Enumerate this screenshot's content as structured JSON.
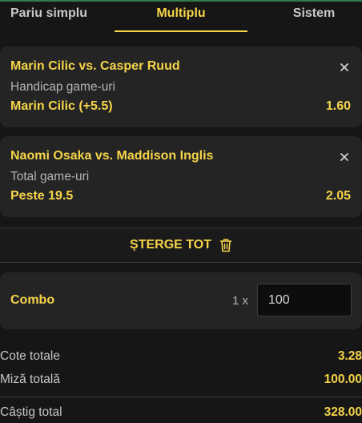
{
  "tabs": [
    {
      "label": "Pariu simplu",
      "active": false
    },
    {
      "label": "Multiplu",
      "active": true
    },
    {
      "label": "Sistem",
      "active": false
    }
  ],
  "selections": [
    {
      "match": "Marin Cilic vs. Casper Ruud",
      "market": "Handicap game-uri",
      "selection": "Marin Cilic (+5.5)",
      "odds": "1.60"
    },
    {
      "match": "Naomi Osaka vs. Maddison Inglis",
      "market": "Total game-uri",
      "selection": "Peste 19.5",
      "odds": "2.05"
    }
  ],
  "clear_all_label": "ȘTERGE TOT",
  "combo": {
    "label": "Combo",
    "multiplier": "1 x",
    "stake": "100"
  },
  "summary": {
    "total_odds_label": "Cote totale",
    "total_odds": "3.28",
    "total_stake_label": "Miză totală",
    "total_stake": "100.00",
    "total_win_label": "Câștig total",
    "total_win": "328.00"
  },
  "colors": {
    "accent": "#f5d44a",
    "background": "#161616",
    "card": "#242424"
  }
}
